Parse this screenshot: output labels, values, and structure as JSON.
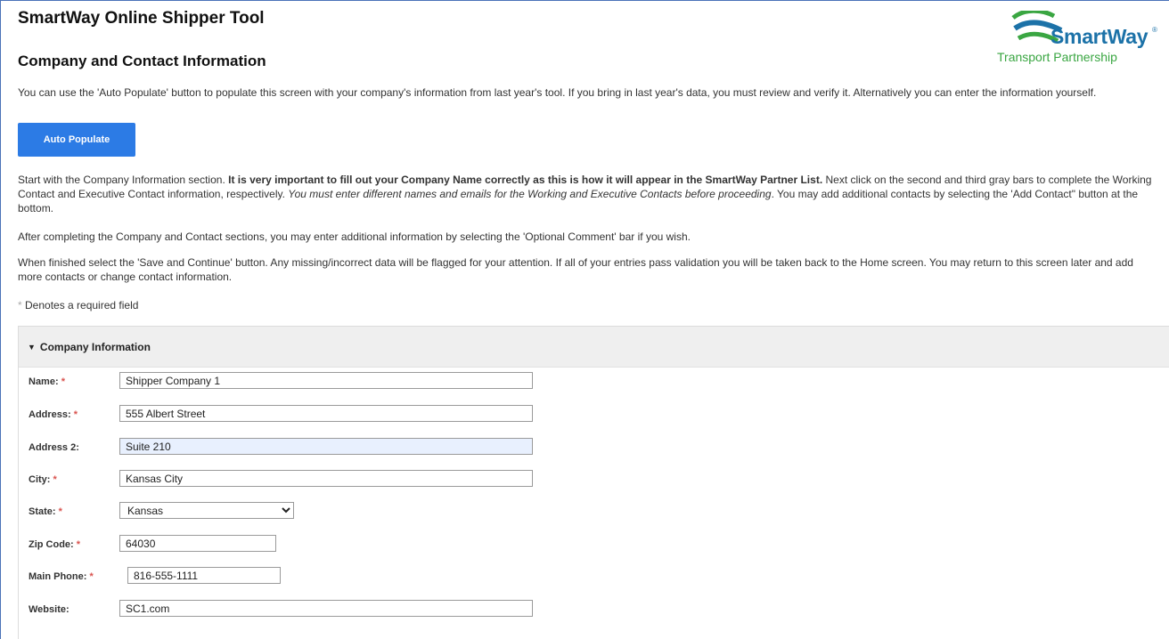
{
  "header": {
    "app_title": "SmartWay Online Shipper Tool",
    "page_title": "Company and Contact Information",
    "logo_name": "SmartWay",
    "logo_tagline": "Transport Partnership",
    "logo_mark": "®"
  },
  "intro": {
    "p1": "You can use the 'Auto Populate' button to populate this screen with your company's information from last year's tool. If you bring in last year's data, you must review and verify it. Alternatively you can enter the information yourself.",
    "auto_populate_label": "Auto Populate",
    "p2_a": "Start with the Company Information section. ",
    "p2_b": "It is very important to fill out your Company Name correctly as this is how it will appear in the SmartWay Partner List.",
    "p2_c": " Next click on the second and third gray bars to complete the Working Contact and Executive Contact information, respectively. ",
    "p2_d": "You must enter different names and emails for the Working and Executive Contacts before proceeding",
    "p2_e": ". You may add additional contacts by selecting the 'Add Contact\" button at the bottom.",
    "p3": "After completing the Company and Contact sections, you may enter additional information by selecting the 'Optional Comment' bar if you wish.",
    "p4": "When finished select the 'Save and Continue' button. Any missing/incorrect data will be flagged for your attention. If all of your entries pass validation you will be taken back to the Home screen. You may return to this screen later and add more contacts or change contact information.",
    "required_marker": "*",
    "required_note": " Denotes a required field"
  },
  "company_section": {
    "caret": "▼",
    "title": "Company Information",
    "fields": {
      "name": {
        "label": "Name:",
        "value": "Shipper Company 1",
        "required": true
      },
      "address": {
        "label": "Address:",
        "value": "555 Albert Street",
        "required": true
      },
      "address2": {
        "label": "Address 2:",
        "value": "Suite 210",
        "required": false
      },
      "city": {
        "label": "City:",
        "value": "Kansas City",
        "required": true
      },
      "state": {
        "label": "State:",
        "value": "Kansas",
        "required": true
      },
      "zip": {
        "label": "Zip Code:",
        "value": "64030",
        "required": true
      },
      "phone": {
        "label": "Main Phone:",
        "value": "816-555-1111",
        "required": true
      },
      "website": {
        "label": "Website:",
        "value": "SC1.com",
        "required": false
      }
    },
    "required_star": "*"
  },
  "colors": {
    "accent": "#2c7be5",
    "required": "#d9534f",
    "brand_blue": "#1c72a8",
    "brand_green": "#3aa642"
  }
}
